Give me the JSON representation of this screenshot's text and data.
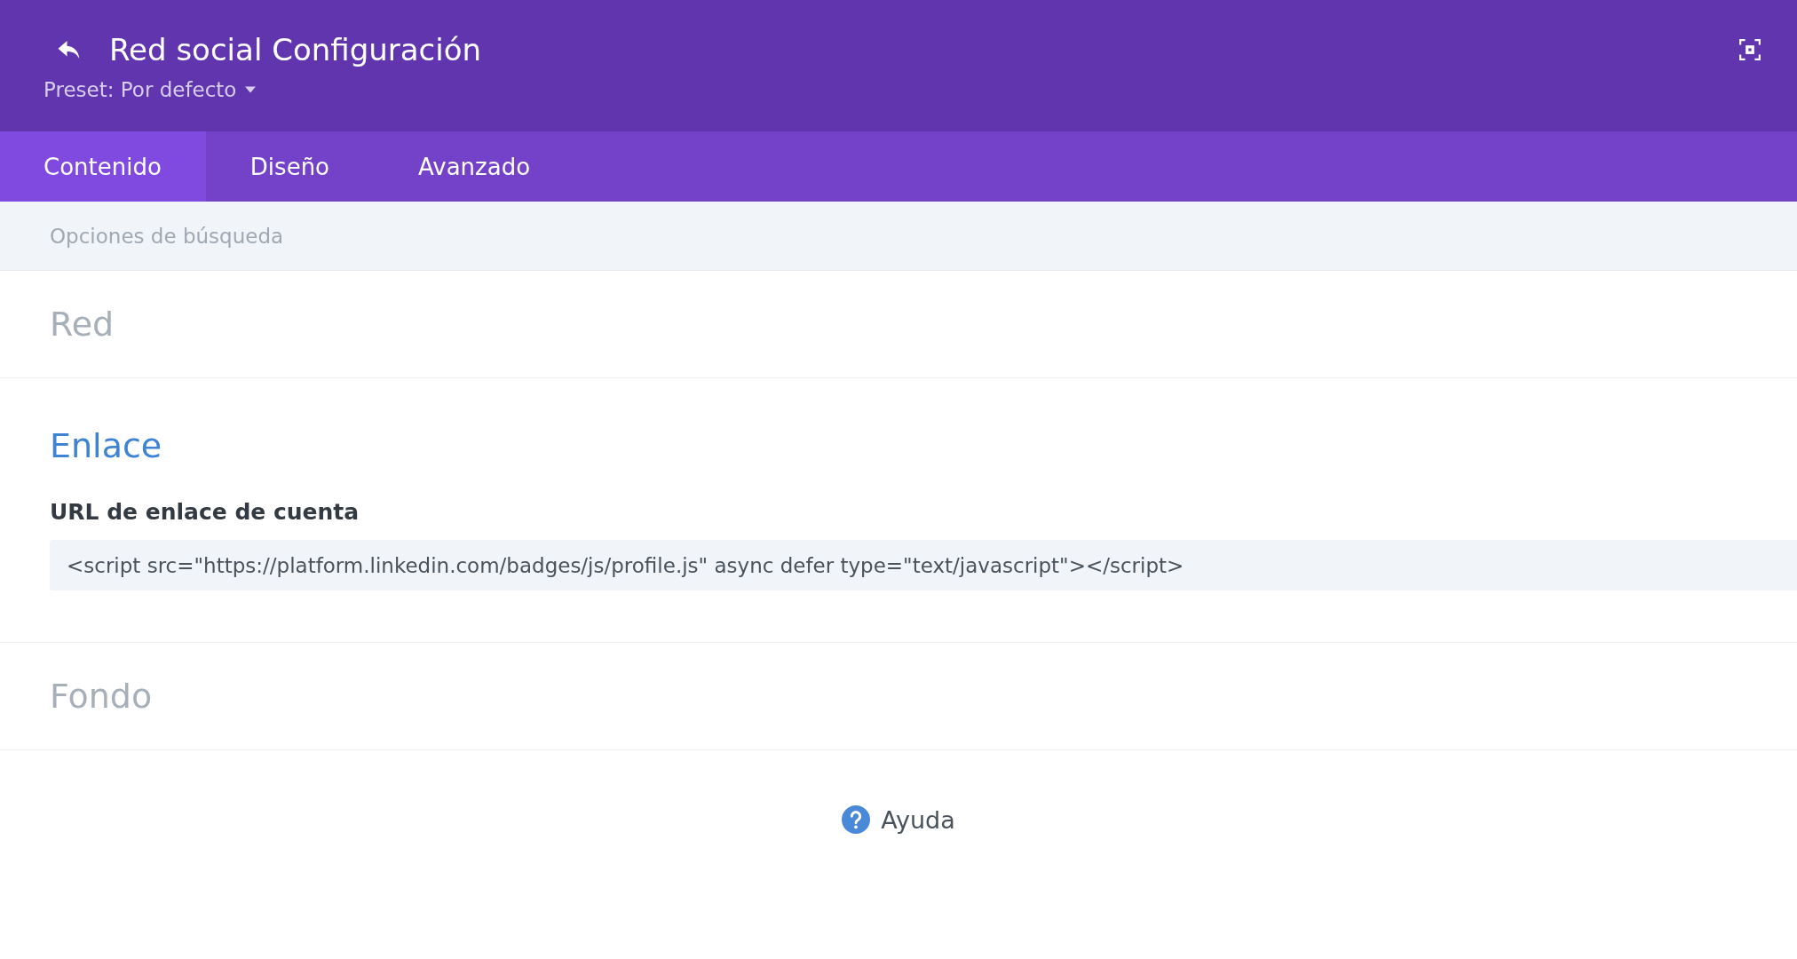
{
  "header": {
    "title": "Red social Configuración",
    "preset": "Preset: Por defecto"
  },
  "tabs": [
    {
      "label": "Contenido",
      "selected": true
    },
    {
      "label": "Diseño",
      "selected": false
    },
    {
      "label": "Avanzado",
      "selected": false
    }
  ],
  "search": {
    "placeholder": "Opciones de búsqueda"
  },
  "sections": [
    {
      "title": "Red",
      "expanded": false
    },
    {
      "title": "Enlace",
      "expanded": true,
      "field": {
        "label": "URL de enlace de cuenta",
        "value": "<script src=\"https://platform.linkedin.com/badges/js/profile.js\" async defer type=\"text/javascript\"></script>"
      }
    },
    {
      "title": "Fondo",
      "expanded": false
    }
  ],
  "help": {
    "label": "Ayuda"
  }
}
